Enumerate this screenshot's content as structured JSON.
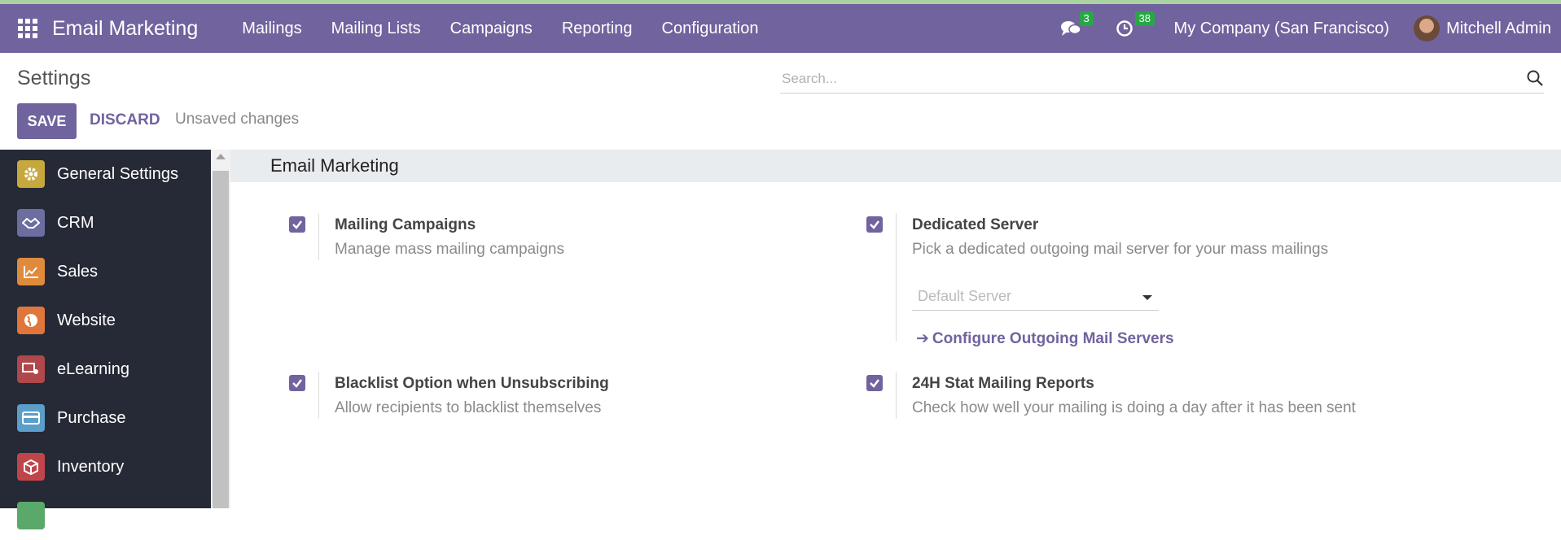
{
  "navbar": {
    "app_name": "Email Marketing",
    "menu": [
      "Mailings",
      "Mailing Lists",
      "Campaigns",
      "Reporting",
      "Configuration"
    ],
    "messages_count": "3",
    "activities_count": "38",
    "company": "My Company (San Francisco)",
    "user": "Mitchell Admin"
  },
  "control": {
    "breadcrumb": "Settings",
    "search_placeholder": "Search...",
    "save_label": "SAVE",
    "discard_label": "DISCARD",
    "status": "Unsaved changes"
  },
  "sidebar": {
    "items": [
      {
        "label": "General Settings",
        "icon": "gear-icon",
        "color": "#c6a83d"
      },
      {
        "label": "CRM",
        "icon": "handshake-icon",
        "color": "#6a6fa0"
      },
      {
        "label": "Sales",
        "icon": "chart-icon",
        "color": "#e08a3c"
      },
      {
        "label": "Website",
        "icon": "globe-icon",
        "color": "#e0763c"
      },
      {
        "label": "eLearning",
        "icon": "elearning-icon",
        "color": "#b0474a"
      },
      {
        "label": "Purchase",
        "icon": "card-icon",
        "color": "#5a9ec9"
      },
      {
        "label": "Inventory",
        "icon": "box-icon",
        "color": "#c0454a"
      }
    ]
  },
  "section": {
    "title": "Email Marketing",
    "settings": [
      {
        "title": "Mailing Campaigns",
        "desc": "Manage mass mailing campaigns",
        "checked": true
      },
      {
        "title": "Dedicated Server",
        "desc": "Pick a dedicated outgoing mail server for your mass mailings",
        "checked": true
      },
      {
        "title": "Blacklist Option when Unsubscribing",
        "desc": "Allow recipients to blacklist themselves",
        "checked": true
      },
      {
        "title": "24H Stat Mailing Reports",
        "desc": "Check how well your mailing is doing a day after it has been sent",
        "checked": true
      }
    ],
    "server_select_placeholder": "Default Server",
    "configure_link": "Configure Outgoing Mail Servers"
  },
  "colors": {
    "brand": "#71639e",
    "sidebar": "#262a36",
    "badge": "#28a745"
  }
}
